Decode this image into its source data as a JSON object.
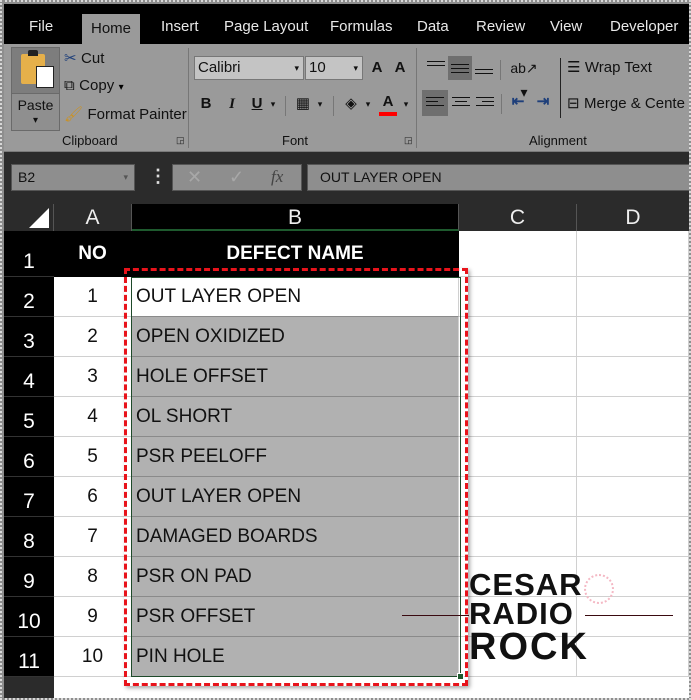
{
  "ribbon_tabs": [
    "File",
    "Home",
    "Insert",
    "Page Layout",
    "Formulas",
    "Data",
    "Review",
    "View",
    "Developer"
  ],
  "active_tab": "Home",
  "clipboard": {
    "paste_label": "Paste",
    "paste_caret": "▾",
    "cut_label": "Cut",
    "copy_label": "Copy",
    "copy_caret": "▾",
    "format_painter_label": "Format Painter",
    "group_label": "Clipboard"
  },
  "font": {
    "font_name": "Calibri",
    "font_size": "10",
    "caret": "▾",
    "grow_label": "A",
    "shrink_label": "A",
    "bold_label": "B",
    "italic_label": "I",
    "underline_label": "U",
    "font_color_label": "A",
    "font_color": "#ff0000",
    "group_label": "Font"
  },
  "alignment": {
    "wrap_text_label": "Wrap Text",
    "merge_center_label": "Merge & Cente",
    "group_label": "Alignment"
  },
  "formula_bar": {
    "name_box": "B2",
    "name_caret": "▾",
    "cancel_icon": "✕",
    "enter_icon": "✓",
    "fx_label": "fx",
    "formula": "OUT LAYER OPEN"
  },
  "columns": [
    "A",
    "B",
    "C",
    "D"
  ],
  "selected_column": "B",
  "rows": [
    "1",
    "2",
    "3",
    "4",
    "5",
    "6",
    "7",
    "8",
    "9",
    "10",
    "11"
  ],
  "table": {
    "headers": [
      "NO",
      "DEFECT NAME"
    ],
    "records": [
      {
        "no": "1",
        "name": "OUT LAYER OPEN"
      },
      {
        "no": "2",
        "name": "OPEN OXIDIZED"
      },
      {
        "no": "3",
        "name": "HOLE OFFSET"
      },
      {
        "no": "4",
        "name": "OL SHORT"
      },
      {
        "no": "5",
        "name": "PSR PEELOFF"
      },
      {
        "no": "6",
        "name": "OUT LAYER OPEN"
      },
      {
        "no": "7",
        "name": "DAMAGED BOARDS"
      },
      {
        "no": "8",
        "name": "PSR ON PAD"
      },
      {
        "no": "9",
        "name": "PSR OFFSET"
      },
      {
        "no": "10",
        "name": "PIN HOLE"
      }
    ]
  },
  "active_cell": "B2",
  "highlight_color": "#e8131b",
  "watermark": {
    "line1": "CESAR",
    "line2": "RADIO",
    "line3": "ROCK"
  }
}
